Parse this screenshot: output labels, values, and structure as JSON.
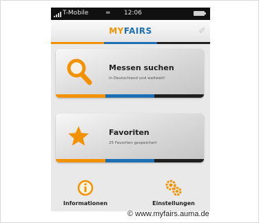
{
  "colors": {
    "accent_orange": "#f39200",
    "accent_blue": "#1b6fb2",
    "stripe_dark": "#1f1f1f",
    "card_base": "#d8d8d8"
  },
  "statusbar": {
    "carrier": "T-Mobile",
    "time": "12:06",
    "signal_icon": "signal-bars-icon",
    "wifi_icon": "wifi-icon",
    "battery_icon": "battery-icon"
  },
  "header": {
    "logo_my": "MY",
    "logo_fairs": "FAIRS",
    "right_icon": "signature-icon"
  },
  "cards": [
    {
      "title": "Messen suchen",
      "subtitle": "in Deutschland und weltweit!",
      "icon": "magnifier-icon"
    },
    {
      "title": "Favoriten",
      "subtitle": "25 Favoriten gespeichert",
      "icon": "star-icon"
    }
  ],
  "bottom": [
    {
      "label": "Informationen",
      "icon": "info-icon"
    },
    {
      "label": "Einstellungen",
      "icon": "gears-icon"
    }
  ],
  "credit": "© www.myfairs.auma.de"
}
